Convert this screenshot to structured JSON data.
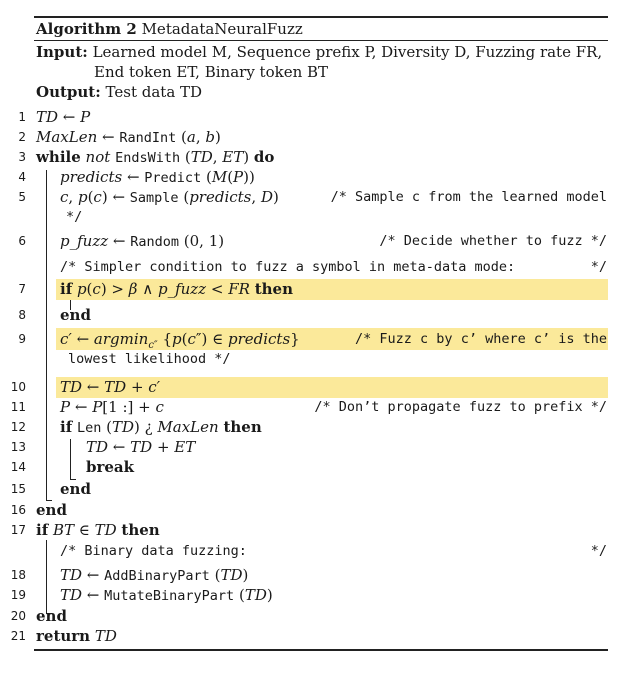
{
  "algorithm": {
    "label": "Algorithm 2",
    "name": "MetadataNeuralFuzz"
  },
  "input": {
    "label": "Input:",
    "line1": "Learned model M, Sequence prefix P, Diversity D, Fuzzing rate FR,",
    "line2": "End token ET, Binary token BT"
  },
  "output": {
    "label": "Output:",
    "text": "Test data TD"
  },
  "lines": [
    {
      "num": "1",
      "code": "TD ← P"
    },
    {
      "num": "2",
      "code": "MaxLen ← RandInt (a, b)"
    },
    {
      "num": "3",
      "code": "while not EndsWith (TD, ET) do"
    },
    {
      "num": "4",
      "code": "predicts ← Predict (M(P))"
    },
    {
      "num": "5",
      "code": "c, p(c) ← Sample (predicts, D)",
      "comment": "/* Sample c from the learned model",
      "comment_cont": "*/"
    },
    {
      "num": "6",
      "code": "p_fuzz ← Random (0, 1)",
      "comment": "/* Decide whether to fuzz */"
    },
    {
      "num": "",
      "code": "/* Simpler condition to fuzz a symbol in meta-data mode:",
      "comment": "*/"
    },
    {
      "num": "7",
      "code": "if p(c) > β ∧ p_fuzz < FR then"
    },
    {
      "num": "8",
      "code": "end"
    },
    {
      "num": "9",
      "code": "c′ ← argmin_c″ {p(c″) ∈ predicts}",
      "comment": "/* Fuzz c by c’ where c’ is the",
      "comment_cont": "lowest likelihood */"
    },
    {
      "num": "10",
      "code": "TD ← TD + c′"
    },
    {
      "num": "11",
      "code": "P ← P[1 :] + c",
      "comment": "/* Don’t propagate fuzz to prefix */"
    },
    {
      "num": "12",
      "code": "if Len (TD) ¿ MaxLen then"
    },
    {
      "num": "13",
      "code": "TD ← TD + ET"
    },
    {
      "num": "14",
      "code": "break"
    },
    {
      "num": "15",
      "code": "end"
    },
    {
      "num": "16",
      "code": "end"
    },
    {
      "num": "17",
      "code": "if BT ∈ TD then"
    },
    {
      "num": "",
      "code": "/* Binary data fuzzing:",
      "comment": "*/"
    },
    {
      "num": "18",
      "code": "TD ← AddBinaryPart (TD)"
    },
    {
      "num": "19",
      "code": "TD ← MutateBinaryPart (TD)"
    },
    {
      "num": "20",
      "code": "end"
    },
    {
      "num": "21",
      "code": "return TD"
    }
  ],
  "highlight_color": "#fbe99a"
}
